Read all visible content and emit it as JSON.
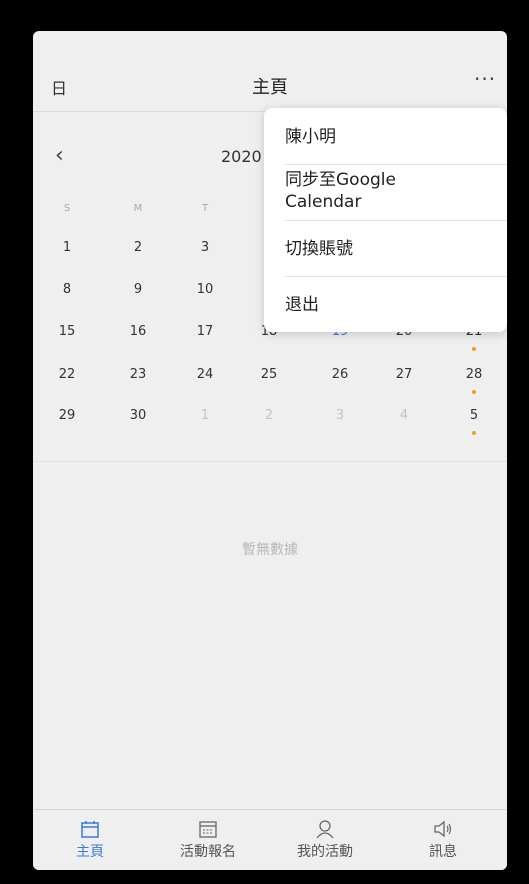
{
  "header": {
    "day_label": "日",
    "title": "主頁",
    "more_glyph": "···"
  },
  "calendar": {
    "prev_glyph": "‹",
    "month_label": "2020",
    "weekdays": [
      "S",
      "M",
      "T"
    ],
    "rows": [
      [
        "1",
        "2",
        "3"
      ],
      [
        "8",
        "9",
        "10"
      ],
      [
        "15",
        "16",
        "17",
        "18",
        "19",
        "20",
        "21"
      ],
      [
        "22",
        "23",
        "24",
        "25",
        "26",
        "27",
        "28"
      ],
      [
        "29",
        "30",
        "1",
        "2",
        "3",
        "4",
        "5"
      ]
    ],
    "today": "19",
    "event_days": [
      "21",
      "28",
      "5"
    ]
  },
  "empty_text": "暫無數據",
  "menu": {
    "user_name": "陳小明",
    "sync_line1": "同步至Google",
    "sync_line2": "Calendar",
    "switch_account": "切換賬號",
    "logout": "退出"
  },
  "tabbar": [
    {
      "label": "主頁",
      "icon": "calendar-icon",
      "active": true
    },
    {
      "label": "活動報名",
      "icon": "calendar-grid-icon",
      "active": false
    },
    {
      "label": "我的活動",
      "icon": "person-icon",
      "active": false
    },
    {
      "label": "訊息",
      "icon": "speaker-icon",
      "active": false
    }
  ],
  "colors": {
    "accent": "#3b7dd8",
    "event_dot": "#f0a020",
    "background": "#efefef"
  }
}
